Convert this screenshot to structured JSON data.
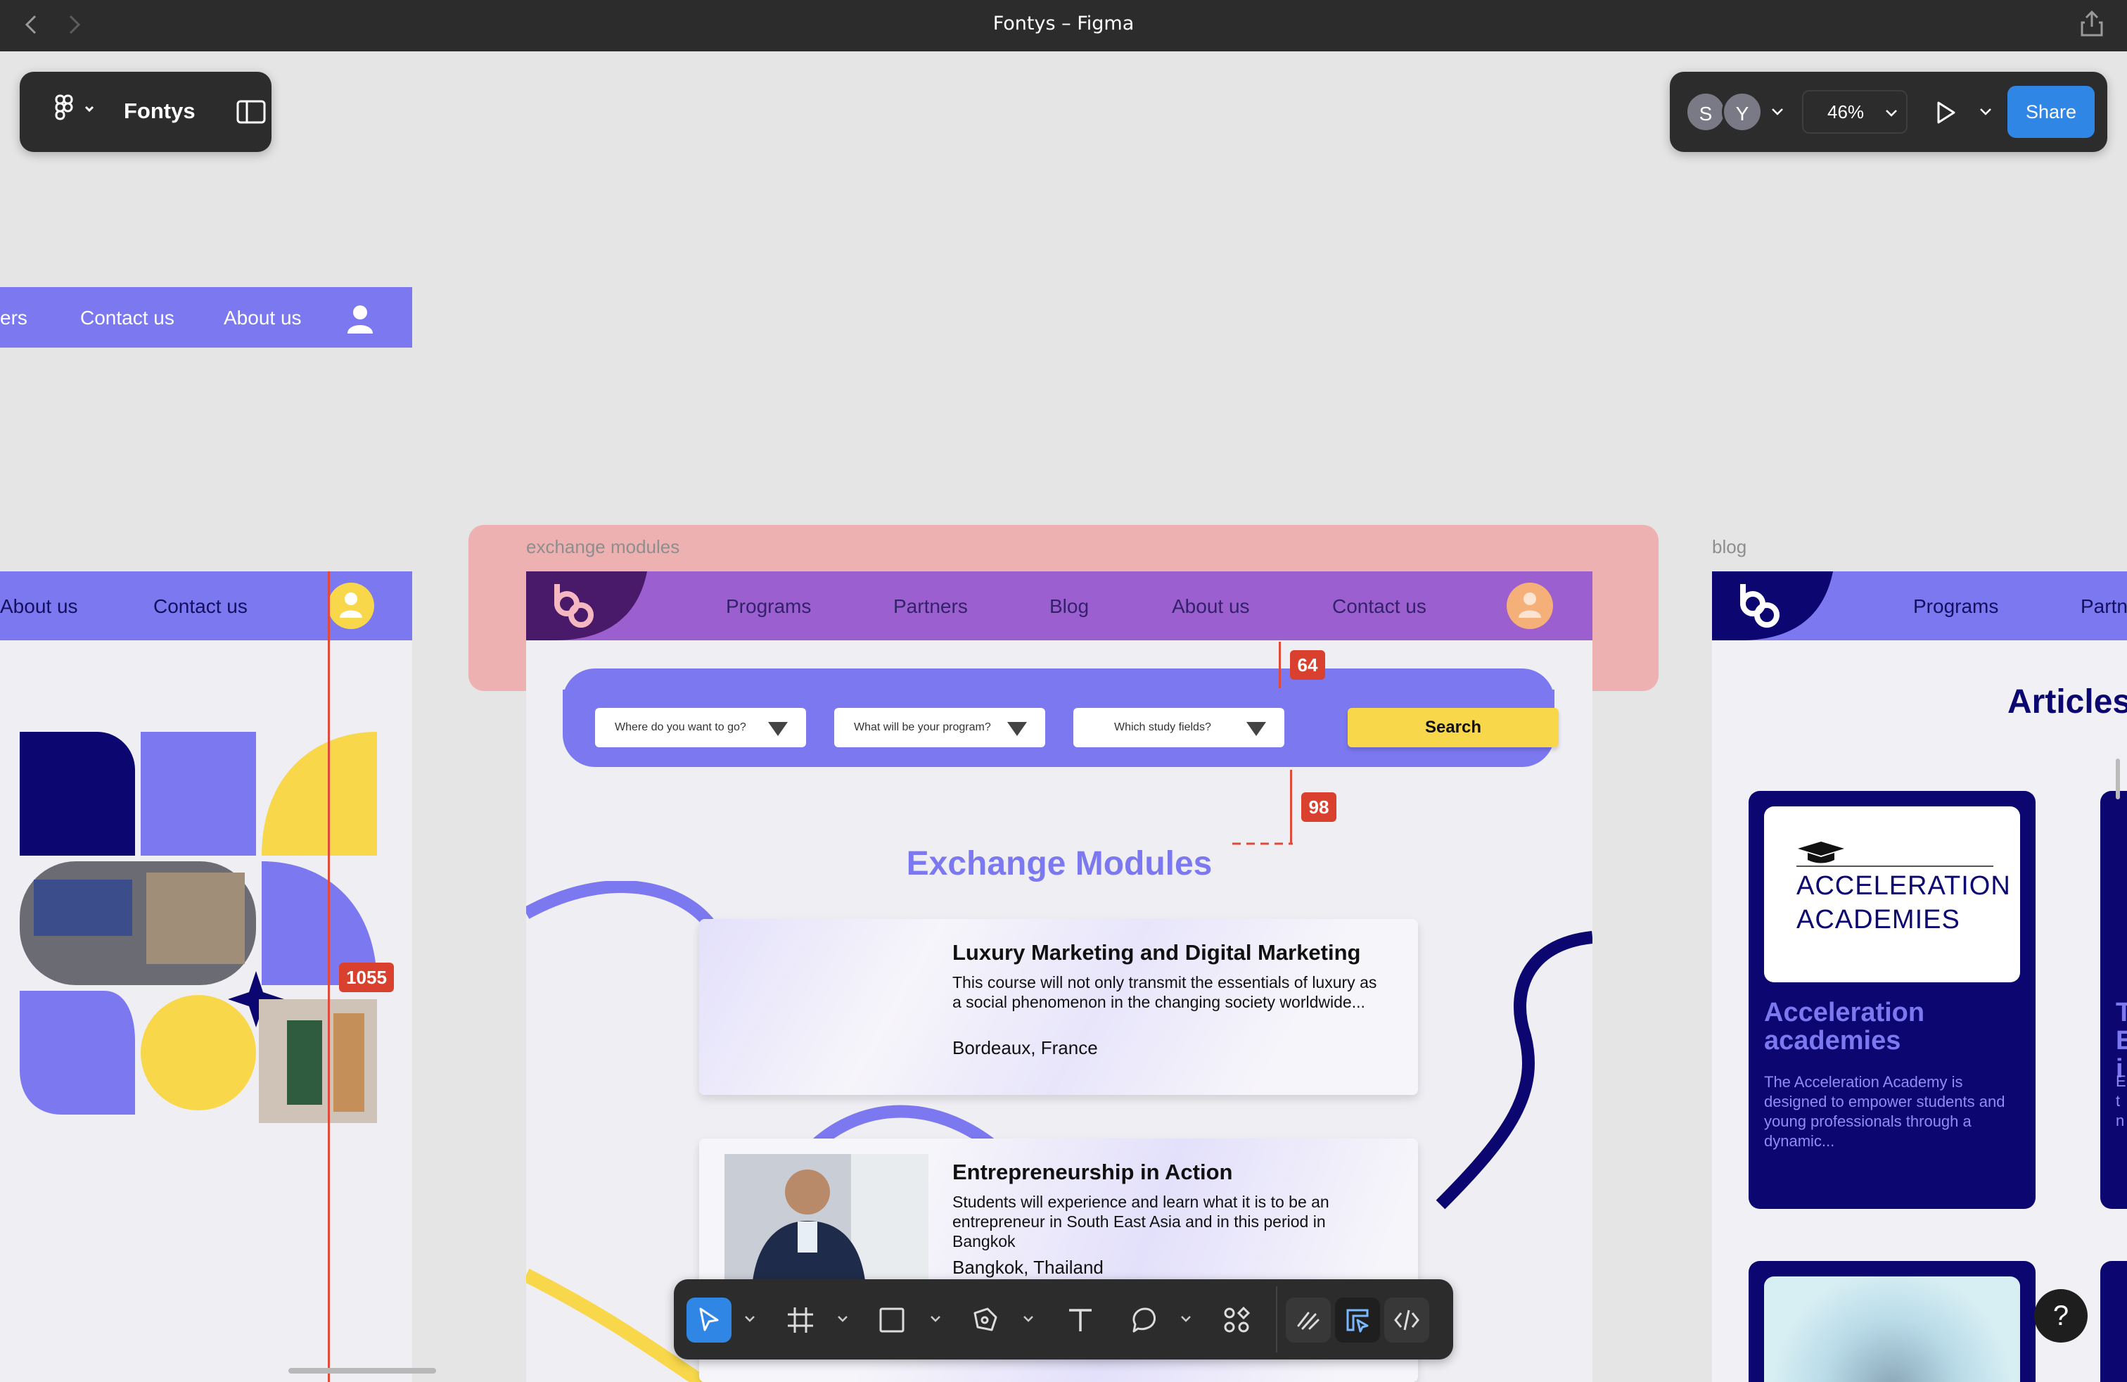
{
  "window": {
    "title": "Fontys – Figma"
  },
  "left_panel": {
    "project_name": "Fontys"
  },
  "right_panel": {
    "avatars": [
      "S",
      "Y"
    ],
    "zoom": "46%",
    "share_label": "Share"
  },
  "top_frame_nav": [
    "ers",
    "Contact us",
    "About us"
  ],
  "left_frame": {
    "nav": [
      "About us",
      "Contact us"
    ],
    "measure_badge": "1055"
  },
  "exchange_frame": {
    "label": "exchange modules",
    "nav": [
      "Programs",
      "Partners",
      "Blog",
      "About us",
      "Contact us"
    ],
    "spacing_top": "64",
    "spacing_bottom": "98",
    "search": {
      "fields": [
        "Where do you want to go?",
        "What will be your program?",
        "Which study fields?"
      ],
      "button": "Search"
    },
    "title": "Exchange Modules",
    "cards": [
      {
        "title": "Luxury Marketing and Digital Marketing",
        "description": "This course will not only transmit the essentials of luxury as a social phenomenon in the changing society worldwide...",
        "location": "Bordeaux, France"
      },
      {
        "title": "Entrepreneurship in Action",
        "description": "Students will experience and learn what it is to be an entrepreneur in South East Asia and in this period in Bangkok",
        "location": "Bangkok, Thailand"
      }
    ]
  },
  "blog_frame": {
    "label": "blog",
    "nav": [
      "Programs",
      "Partn"
    ],
    "heading": "Articles",
    "card": {
      "logo_text_1": "ACCELERATION",
      "logo_text_2": "ACADEMIES",
      "title_1": "Acceleration",
      "title_2": "academies",
      "description": "The Acceleration Academy is designed to empower students and young professionals through a dynamic..."
    },
    "partial_card_letters": [
      "T",
      "E",
      "i"
    ],
    "partial_card_desc": [
      "E",
      "t",
      "n"
    ]
  },
  "help_label": "?",
  "colors": {
    "brand_purple": "#7b78f0",
    "brand_navy": "#0c0670",
    "brand_yellow": "#f8d84a",
    "figma_blue": "#2f86e5",
    "measure_red": "#d9402e"
  },
  "icons": [
    "back-arrow-icon",
    "forward-arrow-icon",
    "share-export-icon",
    "figma-logo-icon",
    "sidebar-toggle-icon",
    "play-icon",
    "move-tool-icon",
    "frame-tool-icon",
    "rectangle-tool-icon",
    "pen-tool-icon",
    "text-tool-icon",
    "comment-tool-icon",
    "actions-icon",
    "draw-mode-icon",
    "design-mode-icon",
    "dev-mode-icon"
  ]
}
